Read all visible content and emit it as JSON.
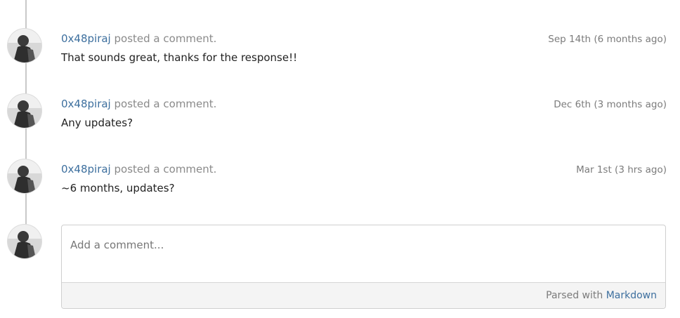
{
  "comments": [
    {
      "author": "0x48piraj",
      "action": "posted a comment.",
      "timestamp": "Sep 14th (6 months ago)",
      "body": "That sounds great, thanks for the response!!"
    },
    {
      "author": "0x48piraj",
      "action": "posted a comment.",
      "timestamp": "Dec 6th (3 months ago)",
      "body": "Any updates?"
    },
    {
      "author": "0x48piraj",
      "action": "posted a comment.",
      "timestamp": "Mar 1st (3 hrs ago)",
      "body": "~6 months, updates?"
    }
  ],
  "composer": {
    "placeholder": "Add a comment...",
    "footer_prefix": "Parsed with",
    "footer_link": "Markdown"
  }
}
